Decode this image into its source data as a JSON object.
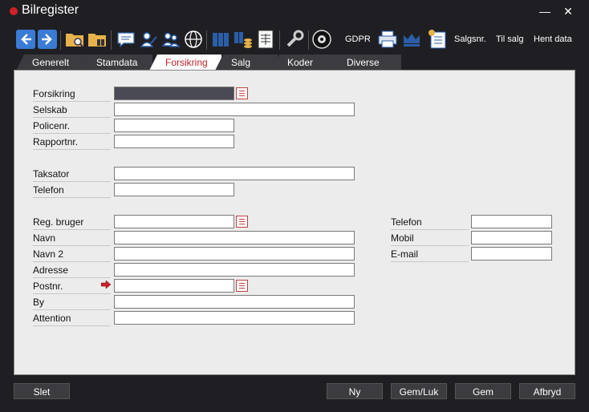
{
  "window": {
    "title": "Bilregister",
    "minimize": "—",
    "close": "✕"
  },
  "toolbar": {
    "gdpr": "GDPR",
    "salgsnr": "Salgsnr.",
    "til_salg": "Til salg",
    "hent_data": "Hent data"
  },
  "tabs": [
    "Generelt",
    "Stamdata",
    "Forsikring",
    "Salg",
    "Koder",
    "Diverse"
  ],
  "active_tab": "Forsikring",
  "form": {
    "forsikring": "Forsikring",
    "selskab": "Selskab",
    "policenr": "Policenr.",
    "rapportnr": "Rapportnr.",
    "taksator": "Taksator",
    "telefon1": "Telefon",
    "reg_bruger": "Reg. bruger",
    "navn": "Navn",
    "navn2": "Navn 2",
    "adresse": "Adresse",
    "postnr": "Postnr.",
    "by": "By",
    "attention": "Attention",
    "telefon2": "Telefon",
    "mobil": "Mobil",
    "email": "E-mail"
  },
  "buttons": {
    "slet": "Slet",
    "ny": "Ny",
    "gem_luk": "Gem/Luk",
    "gem": "Gem",
    "afbryd": "Afbryd"
  },
  "colors": {
    "accent": "#c0202a",
    "dark": "#1f1f23",
    "tab": "#3b3b40"
  }
}
